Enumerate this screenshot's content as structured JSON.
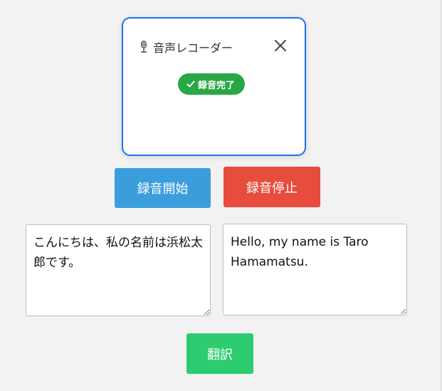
{
  "popup": {
    "title": "音声レコーダー",
    "mic_icon": "microphone-icon",
    "close_icon": "close-icon",
    "status_label": "録音完了",
    "status_icon": "check-icon",
    "accent_color": "#1a73e8",
    "status_color": "#28a745"
  },
  "controls": {
    "start_label": "録音開始",
    "stop_label": "録音停止",
    "translate_label": "翻訳",
    "start_color": "#3b9ddc",
    "stop_color": "#e74c3c",
    "translate_color": "#2ecc71"
  },
  "source_text": {
    "value": "こんにちは、私の名前は浜松太郎です。"
  },
  "translated_text": {
    "value": "Hello, my name is Taro Hamamatsu."
  }
}
